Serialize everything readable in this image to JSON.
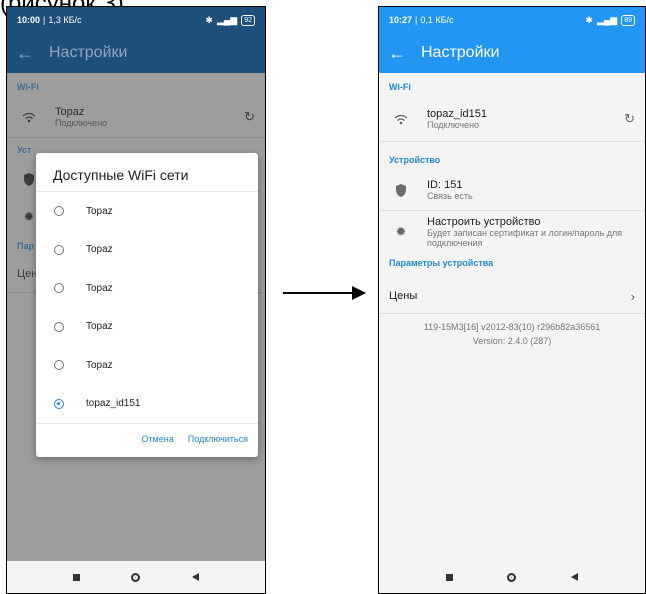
{
  "caption": "(рисунок 3),",
  "left": {
    "status": {
      "time": "10:00",
      "speed": "1,3 КБ/с",
      "battery": "92"
    },
    "appbar": {
      "back": "←",
      "title": "Настройки"
    },
    "sections": {
      "wifi": "Wi-Fi",
      "device": "Уст",
      "params": "Пар"
    },
    "wifi_item": {
      "title": "Topaz",
      "subtitle": "Подключено"
    },
    "prices_label": "Цен",
    "dialog": {
      "title": "Доступные WiFi сети",
      "options": [
        "Topaz",
        "Topaz",
        "Topaz",
        "Topaz",
        "Topaz",
        "topaz_id151"
      ],
      "selected_index": 5,
      "cancel": "Отмена",
      "connect": "Подключиться"
    }
  },
  "right": {
    "status": {
      "time": "10:27",
      "speed": "0,1 КБ/с",
      "battery": "89"
    },
    "appbar": {
      "back": "←",
      "title": "Настройки"
    },
    "wifi_header": "Wi-Fi",
    "wifi_item": {
      "title": "topaz_id151",
      "subtitle": "Подключено"
    },
    "device_header": "Устройство",
    "id_item": {
      "title": "ID: 151",
      "subtitle": "Связь есть"
    },
    "configure_item": {
      "title": "Настроить устройство",
      "subtitle": "Будет записан сертификат и логин/пароль для подключения"
    },
    "params_header": "Параметры устройства",
    "prices_item": {
      "title": "Цены"
    },
    "version_line1": "119-15М3[16] v2012-83(10) r296b82a36561",
    "version_line2": "Version: 2.4.0 (287)"
  },
  "icons": {
    "wifi": "wifi-icon",
    "refresh": "refresh-icon",
    "shield": "shield-icon",
    "gear": "gear-icon",
    "chevron": "chevron-right-icon"
  },
  "colors": {
    "primary": "#2196f3",
    "accent": "#1e88e5"
  }
}
